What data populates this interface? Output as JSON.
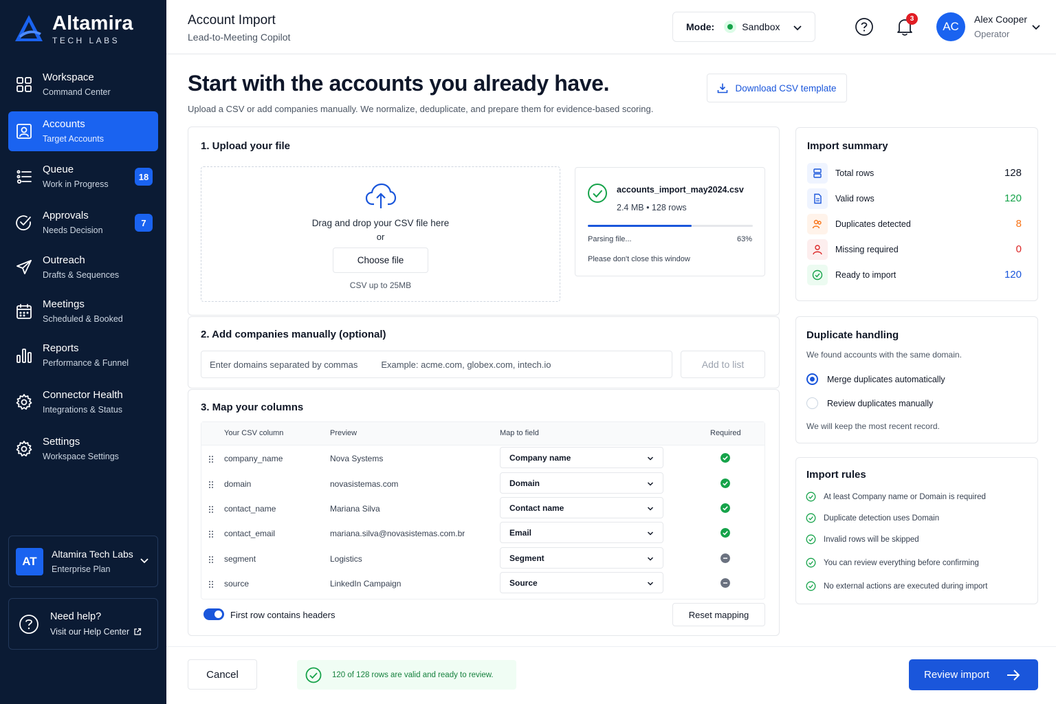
{
  "brand": {
    "name": "Altamira",
    "sub": "TECH LABS"
  },
  "nav": [
    {
      "title": "Workspace",
      "sub": "Command Center",
      "icon": "grid-icon",
      "badge": ""
    },
    {
      "title": "Accounts",
      "sub": "Target Accounts",
      "icon": "contact-card-icon",
      "badge": ""
    },
    {
      "title": "Queue",
      "sub": "Work in Progress",
      "icon": "queue-list-icon",
      "badge": "18"
    },
    {
      "title": "Approvals",
      "sub": "Needs Decision",
      "icon": "check-circle-icon",
      "badge": "7"
    },
    {
      "title": "Outreach",
      "sub": "Drafts & Sequences",
      "icon": "paper-plane-icon",
      "badge": ""
    },
    {
      "title": "Meetings",
      "sub": "Scheduled & Booked",
      "icon": "calendar-icon",
      "badge": ""
    },
    {
      "title": "Reports",
      "sub": "Performance & Funnel",
      "icon": "bar-chart-icon",
      "badge": ""
    },
    {
      "title": "Connector Health",
      "sub": "Integrations & Status",
      "icon": "gear-icon",
      "badge": ""
    },
    {
      "title": "Settings",
      "sub": "Workspace Settings",
      "icon": "gear-icon",
      "badge": ""
    }
  ],
  "org": {
    "initials": "AT",
    "name": "Altamira Tech Labs",
    "plan": "Enterprise Plan"
  },
  "help": {
    "title": "Need help?",
    "link": "Visit our Help Center"
  },
  "header": {
    "title": "Account Import",
    "subtitle": "Lead-to-Meeting Copilot",
    "mode_label": "Mode:",
    "mode_value": "Sandbox",
    "notifications": "3",
    "user_initials": "AC",
    "user_name": "Alex Cooper",
    "user_role": "Operator"
  },
  "hero": {
    "title": "Start with the accounts you already have.",
    "subtitle": "Upload a CSV or add companies manually. We normalize, deduplicate, and prepare them for evidence-based scoring.",
    "download_label": "Download CSV template"
  },
  "upload": {
    "title": "1. Upload your file",
    "drop_text": "Drag and drop your CSV file here",
    "or_text": "or",
    "choose_label": "Choose file",
    "hint": "CSV up to 25MB",
    "file_name": "accounts_import_may2024.csv",
    "file_meta": "2.4 MB • 128 rows",
    "progress": 0.63,
    "parse_text": "Parsing file...",
    "parse_pct": "63%",
    "note": "Please don't close this window"
  },
  "manual": {
    "title": "2. Add companies manually (optional)",
    "placeholder": "Enter domains separated by commas",
    "example": "Example: acme.com, globex.com, intech.io",
    "add_label": "Add to list"
  },
  "mapping": {
    "title": "3. Map your columns",
    "headers": [
      "Your CSV column",
      "Preview",
      "Map to field",
      "Required"
    ],
    "rows": [
      {
        "column": "company_name",
        "preview": "Nova Systems",
        "field": "Company name",
        "required": true
      },
      {
        "column": "domain",
        "preview": "novasistemas.com",
        "field": "Domain",
        "required": true
      },
      {
        "column": "contact_name",
        "preview": "Mariana Silva",
        "field": "Contact name",
        "required": true
      },
      {
        "column": "contact_email",
        "preview": "mariana.silva@novasistemas.com.br",
        "field": "Email",
        "required": true
      },
      {
        "column": "segment",
        "preview": "Logistics",
        "field": "Segment",
        "required": false
      },
      {
        "column": "source",
        "preview": "LinkedIn Campaign",
        "field": "Source",
        "required": false
      }
    ],
    "toggle_label": "First row contains headers",
    "reset_label": "Reset mapping"
  },
  "summary": {
    "title": "Import summary",
    "rows": [
      {
        "label": "Total rows",
        "value": "128",
        "color": "#111827",
        "icon": "list-icon"
      },
      {
        "label": "Valid rows",
        "value": "120",
        "color": "#16a34a",
        "icon": "document-icon"
      },
      {
        "label": "Duplicates detected",
        "value": "8",
        "color": "#f97316",
        "icon": "users-icon"
      },
      {
        "label": "Missing required",
        "value": "0",
        "color": "#dc2626",
        "icon": "user-alert-icon"
      },
      {
        "label": "Ready to import",
        "value": "120",
        "color": "#1a56db",
        "icon": "check-circle-icon"
      }
    ]
  },
  "duplicates": {
    "title": "Duplicate handling",
    "desc": "We found accounts with the same domain.",
    "option1": "Merge duplicates automatically",
    "option2": "Review duplicates manually",
    "note": "We will keep the most recent record."
  },
  "rules": {
    "title": "Import rules",
    "items": [
      "At least Company name or Domain is required",
      "Duplicate detection uses Domain",
      "Invalid rows will be skipped",
      "You can review everything before confirming",
      "No external actions are executed during import"
    ]
  },
  "footer": {
    "cancel_label": "Cancel",
    "status": "120 of 128 rows are valid and ready to review.",
    "review_label": "Review import"
  }
}
